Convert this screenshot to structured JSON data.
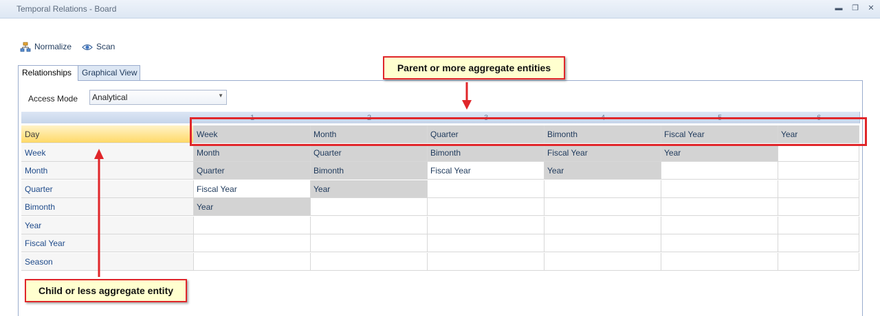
{
  "window": {
    "title": "Temporal Relations - Board",
    "minimize": "▬",
    "restore": "❐",
    "close": "✕"
  },
  "toolbar": {
    "normalize_label": "Normalize",
    "scan_label": "Scan"
  },
  "tabs": [
    {
      "label": "Relationships"
    },
    {
      "label": "Graphical View"
    }
  ],
  "access_mode": {
    "label": "Access Mode",
    "value": "Analytical"
  },
  "grid": {
    "columns": [
      "1",
      "2",
      "3",
      "4",
      "5",
      "6"
    ],
    "rows": [
      {
        "label": "Day",
        "cells": [
          "Week",
          "Month",
          "Quarter",
          "Bimonth",
          "Fiscal Year",
          "Year"
        ]
      },
      {
        "label": "Week",
        "cells": [
          "Month",
          "Quarter",
          "Bimonth",
          "Fiscal Year",
          "Year",
          ""
        ]
      },
      {
        "label": "Month",
        "cells": [
          "Quarter",
          "Bimonth",
          "Fiscal Year",
          "Year",
          "",
          ""
        ]
      },
      {
        "label": "Quarter",
        "cells": [
          "Fiscal Year",
          "Year",
          "",
          "",
          "",
          ""
        ]
      },
      {
        "label": "Bimonth",
        "cells": [
          "Year",
          "",
          "",
          "",
          "",
          ""
        ]
      },
      {
        "label": "Year",
        "cells": [
          "",
          "",
          "",
          "",
          "",
          ""
        ]
      },
      {
        "label": "Fiscal Year",
        "cells": [
          "",
          "",
          "",
          "",
          "",
          ""
        ]
      },
      {
        "label": "Season",
        "cells": [
          "",
          "",
          "",
          "",
          "",
          ""
        ]
      }
    ]
  },
  "annotations": {
    "parent": "Parent or more aggregate entities",
    "child": "Child or less aggregate entity"
  },
  "colors": {
    "annotation_red": "#e0262a",
    "callout_bg": "#ffffcf",
    "filled_cell": "#d3d3d3",
    "selected_row": "#ffd968"
  }
}
